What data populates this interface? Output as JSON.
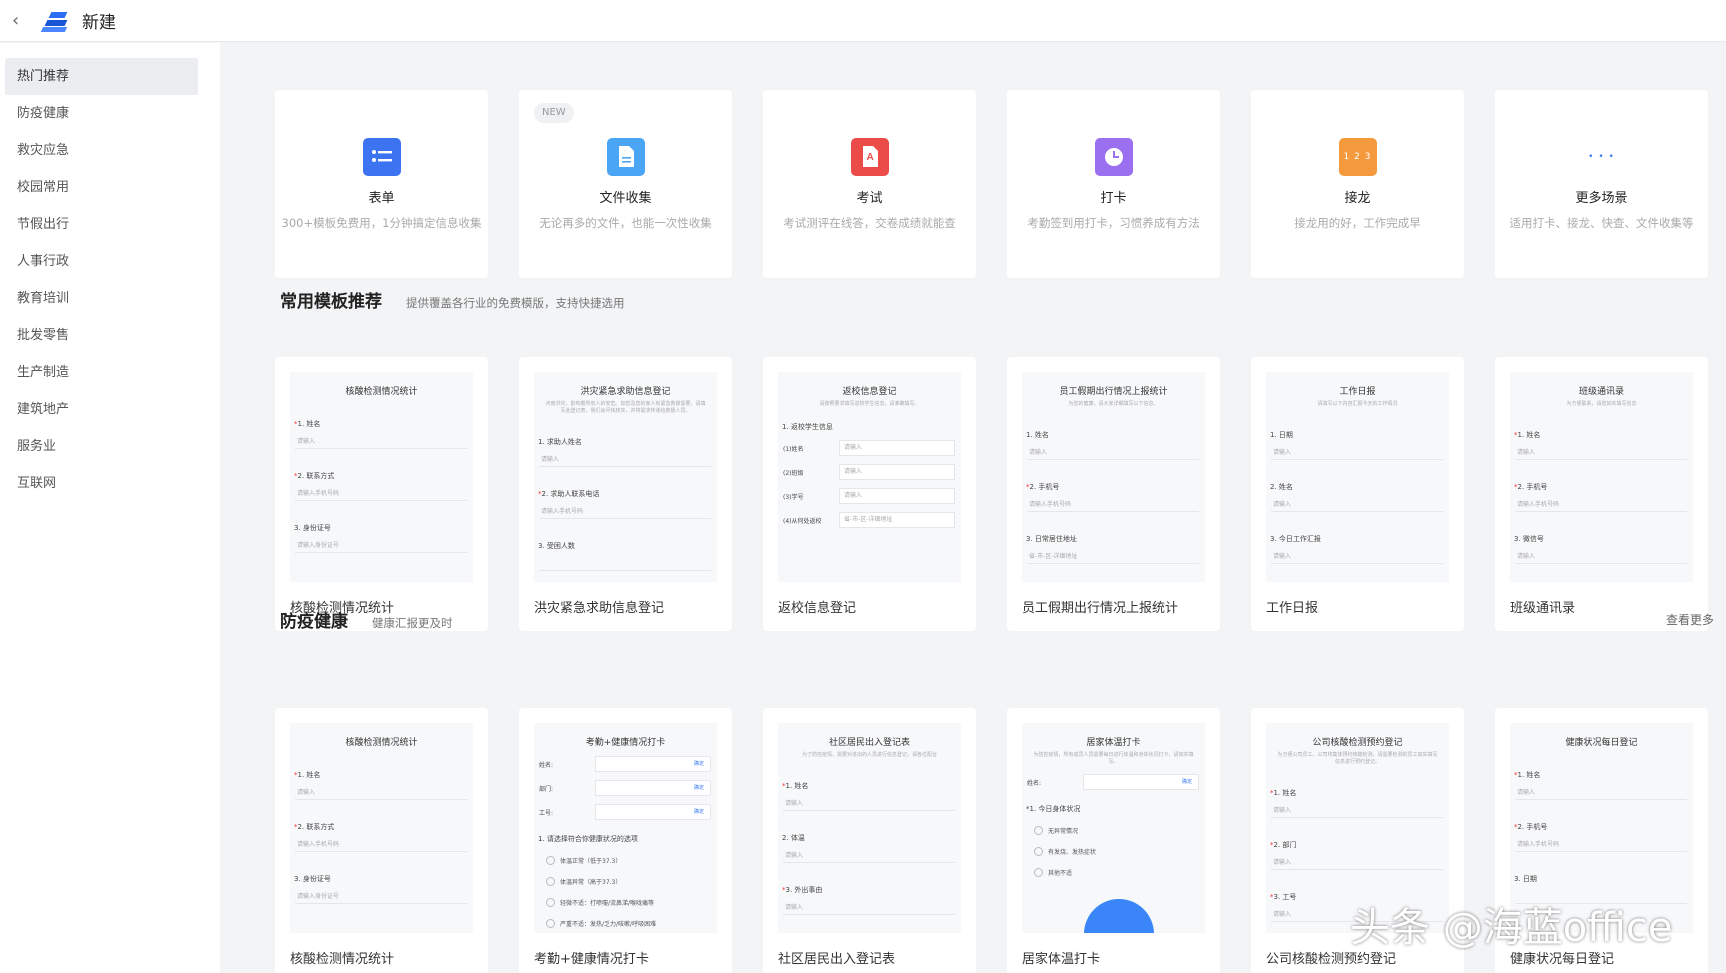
{
  "header": {
    "back_icon": "chevron-left-icon",
    "title": "新建"
  },
  "sidebar": {
    "items": [
      {
        "label": "热门推荐",
        "active": true
      },
      {
        "label": "防疫健康"
      },
      {
        "label": "救灾应急"
      },
      {
        "label": "校园常用"
      },
      {
        "label": "节假出行"
      },
      {
        "label": "人事行政"
      },
      {
        "label": "教育培训"
      },
      {
        "label": "批发零售"
      },
      {
        "label": "生产制造"
      },
      {
        "label": "建筑地产"
      },
      {
        "label": "服务业"
      },
      {
        "label": "互联网"
      }
    ]
  },
  "features": [
    {
      "name": "表单",
      "desc": "300+模板免费用，1分钟搞定信息收集",
      "icon": "list-form-icon",
      "color": "#3c73f0"
    },
    {
      "name": "文件收集",
      "desc": "无论再多的文件，也能一次性收集",
      "icon": "file-icon",
      "color": "#4aa6f5",
      "badge": "NEW"
    },
    {
      "name": "考试",
      "desc": "考试测评在线答，交卷成绩就能查",
      "icon": "exam-icon",
      "color": "#ec4c48"
    },
    {
      "name": "打卡",
      "desc": "考勤签到用打卡，习惯养成有方法",
      "icon": "clock-icon",
      "color": "#9a6ff0"
    },
    {
      "name": "接龙",
      "desc": "接龙用的好，工作完成早",
      "icon": "number-sequence-icon",
      "color": "#f59a3c",
      "icon_text": "1 2 3"
    },
    {
      "name": "更多场景",
      "desc": "适用打卡、接龙、快查、文件收集等",
      "icon": "more-dots-icon",
      "color": "#3a7bf5",
      "icon_text": "• • •"
    }
  ],
  "section_common": {
    "title": "常用模板推荐",
    "subtitle": "提供覆盖各行业的免费模版，支持快捷选用"
  },
  "common_templates": [
    {
      "name": "核酸检测情况统计",
      "thumb": {
        "title": "核酸检测情况统计",
        "fields": [
          {
            "req": "*",
            "label": "1. 姓名",
            "ph": "请输入"
          },
          {
            "req": "*",
            "label": "2. 联系方式",
            "ph": "请输入手机号码"
          },
          {
            "req": "",
            "label": "3. 身份证号",
            "ph": "请输入身份证号"
          }
        ]
      }
    },
    {
      "name": "洪灾紧急求助信息登记",
      "thumb": {
        "title": "洪灾紧急求助信息登记",
        "desc": "河南洪灾，影响着所有人的安危。如您及您的家人有紧急救援需要，请填写此登记表，我们会尽快核实，并将需求传递给救援人员。",
        "fields": [
          {
            "req": "",
            "label": "1. 求助人姓名",
            "ph": "请输入"
          },
          {
            "req": "*",
            "label": "2. 求助人联系电话",
            "ph": "请输入手机号码"
          },
          {
            "req": "",
            "label": "3. 受困人数",
            "ph": ""
          }
        ]
      }
    },
    {
      "name": "返校信息登记",
      "thumb": {
        "title": "返校信息登记",
        "desc": "请按照要求填写返校学生信息，请准确填写。",
        "group": "1. 返校学生信息",
        "rows": [
          {
            "label": "(1)姓名",
            "ph": "请输入"
          },
          {
            "label": "(2)班级",
            "ph": "请输入"
          },
          {
            "label": "(3)学号",
            "ph": "请输入"
          },
          {
            "label": "(4)从何处返校",
            "ph": "省-市-区-详细地址"
          }
        ]
      }
    },
    {
      "name": "员工假期出行情况上报统计",
      "thumb": {
        "title": "员工假期出行情况上报统计",
        "desc": "为您的健康，请大家详细填写以下信息。",
        "fields": [
          {
            "req": "",
            "label": "1. 姓名",
            "ph": "请输入"
          },
          {
            "req": "*",
            "label": "2. 手机号",
            "ph": "请输入手机号码"
          },
          {
            "req": "",
            "label": "3. 日常居住地址",
            "ph": "省-市-区-详细地址"
          }
        ]
      }
    },
    {
      "name": "工作日报",
      "thumb": {
        "title": "工作日报",
        "desc": "请填写以下内容汇报今天的工作情况",
        "fields": [
          {
            "req": "",
            "label": "1. 日期",
            "ph": "请输入"
          },
          {
            "req": "",
            "label": "2. 姓名",
            "ph": "请输入"
          },
          {
            "req": "",
            "label": "3. 今日工作汇报",
            "ph": "请输入"
          }
        ]
      }
    },
    {
      "name": "班级通讯录",
      "thumb": {
        "title": "班级通讯录",
        "desc": "为方便联系，请您如实填写信息",
        "fields": [
          {
            "req": "*",
            "label": "1. 姓名",
            "ph": "请输入"
          },
          {
            "req": "*",
            "label": "2. 手机号",
            "ph": "请输入手机号码"
          },
          {
            "req": "",
            "label": "3. 微信号",
            "ph": "请输入"
          }
        ]
      }
    }
  ],
  "section_health": {
    "title": "防疫健康",
    "subtitle": "健康汇报更及时",
    "more": "查看更多"
  },
  "health_templates": [
    {
      "name": "核酸检测情况统计",
      "thumb": {
        "title": "核酸检测情况统计",
        "fields": [
          {
            "req": "*",
            "label": "1. 姓名",
            "ph": "请输入"
          },
          {
            "req": "*",
            "label": "2. 联系方式",
            "ph": "请输入手机号码"
          },
          {
            "req": "",
            "label": "3. 身份证号",
            "ph": "请输入身份证号"
          }
        ]
      }
    },
    {
      "name": "考勤+健康情况打卡",
      "thumb": {
        "title": "考勤+健康情况打卡",
        "rows": [
          {
            "label": "姓名:",
            "ph": "",
            "ok": "确定"
          },
          {
            "label": "部门:",
            "ph": "",
            "ok": "确定"
          },
          {
            "label": "工号:",
            "ph": "",
            "ok": "确定"
          }
        ],
        "question": "1. 请选择符合你健康状况的选项",
        "options": [
          "体温正常（低于37.3）",
          "体温异常（高于37.3）",
          "轻微不适：打喷嚏/流鼻涕/喉咙痛等",
          "严重不适：发热/乏力/咳嗽/呼吸困难"
        ]
      }
    },
    {
      "name": "社区居民出入登记表",
      "thumb": {
        "title": "社区居民出入登记表",
        "desc": "为了防控疫情，需要对进出的人员进行信息登记，请各位配合",
        "fields": [
          {
            "req": "*",
            "label": "1. 姓名",
            "ph": "请输入"
          },
          {
            "req": "",
            "label": "2. 体温",
            "ph": "请输入"
          },
          {
            "req": "*",
            "label": "3. 外出事由",
            "ph": "请输入"
          }
        ]
      }
    },
    {
      "name": "居家体温打卡",
      "thumb": {
        "title": "居家体温打卡",
        "desc": "为防控疫情，所有成员人员需要每日进行体温和身体状况打卡，请如实填写。",
        "rows": [
          {
            "label": "姓名:",
            "ph": "",
            "ok": "确定"
          }
        ],
        "question": "*1. 今日身体状况",
        "options": [
          "无异常情况",
          "有发烧、发热症状",
          "其他不适"
        ]
      }
    },
    {
      "name": "公司核酸检测预约登记",
      "thumb": {
        "title": "公司核酸检测预约登记",
        "desc": "为方便公司员工，公司将集体预约核酸检测，请需要检测的员工如实填写信息进行预约登记。",
        "fields": [
          {
            "req": "*",
            "label": "1. 姓名",
            "ph": "请输入"
          },
          {
            "req": "*",
            "label": "2. 部门",
            "ph": "请输入"
          },
          {
            "req": "*",
            "label": "3. 工号",
            "ph": "请输入"
          }
        ]
      }
    },
    {
      "name": "健康状况每日登记",
      "thumb": {
        "title": "健康状况每日登记",
        "fields": [
          {
            "req": "*",
            "label": "1. 姓名",
            "ph": "请输入"
          },
          {
            "req": "*",
            "label": "2. 手机号",
            "ph": "请输入手机号码"
          },
          {
            "req": "",
            "label": "3. 日期",
            "ph": ""
          }
        ]
      }
    }
  ],
  "watermark": "头条 @海蓝office"
}
